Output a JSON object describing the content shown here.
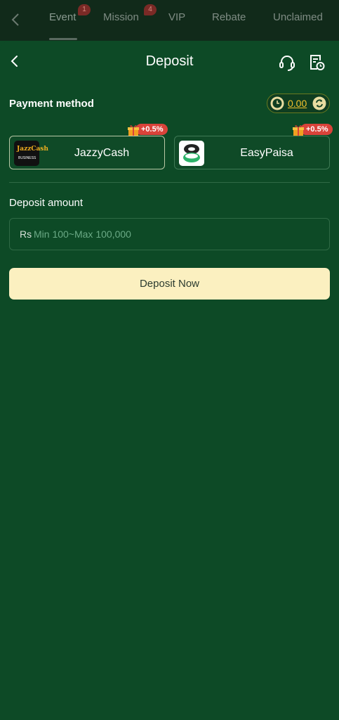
{
  "top_tabs": {
    "items": [
      {
        "label": "Event",
        "badge": "1"
      },
      {
        "label": "Mission",
        "badge": "4"
      },
      {
        "label": "VIP"
      },
      {
        "label": "Rebate"
      },
      {
        "label": "Unclaimed"
      }
    ],
    "active": "Event"
  },
  "header": {
    "title": "Deposit"
  },
  "payment": {
    "label": "Payment method",
    "balance": "0.00",
    "methods": [
      {
        "name": "JazzyCash",
        "bonus": "+0.5%",
        "logo_text": "JazzCash",
        "logo_sub": "BUSINESS",
        "selected": true
      },
      {
        "name": "EasyPaisa",
        "bonus": "+0.5%",
        "selected": false
      }
    ]
  },
  "amount": {
    "label": "Deposit amount",
    "currency": "Rs",
    "placeholder": "Min 100~Max 100,000",
    "value": ""
  },
  "deposit_button": {
    "label": "Deposit Now"
  },
  "colors": {
    "background": "#0d4a26",
    "button": "#fbf0c0",
    "bonus_tag": "#d9433a",
    "balance": "#f2c22e"
  }
}
